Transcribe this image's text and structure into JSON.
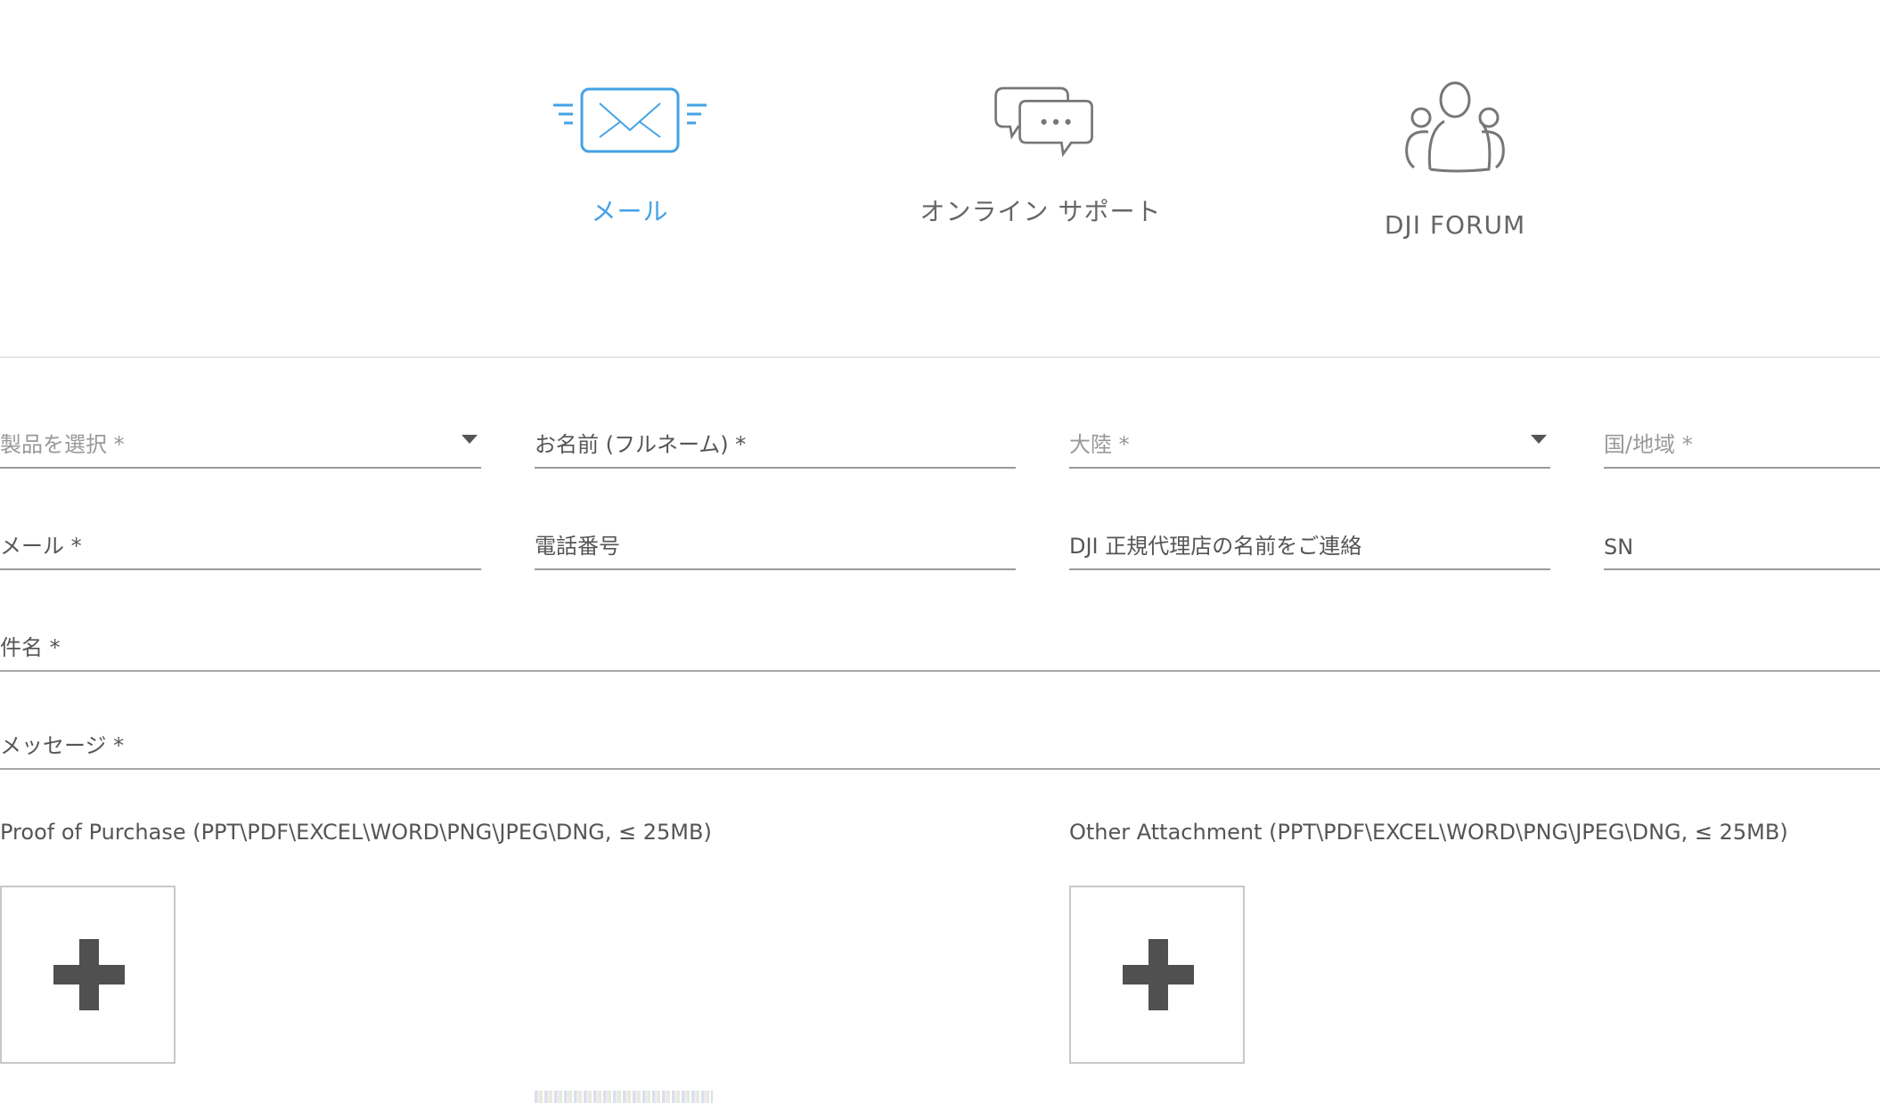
{
  "tabs": [
    {
      "label": "メール",
      "icon": "mail-icon",
      "active": true
    },
    {
      "label": "オンライン サポート",
      "icon": "chat-bubbles-icon",
      "active": false
    },
    {
      "label": "DJI FORUM",
      "icon": "community-icon",
      "active": false
    }
  ],
  "form": {
    "product": "製品を選択 *",
    "full_name": "お名前 (フルネーム) *",
    "continent": "大陸 *",
    "country": "国/地域 *",
    "email": "メール *",
    "phone": "電話番号",
    "dealer": "DJI 正規代理店の名前をご連絡",
    "sn": "SN",
    "subject": "件名 *",
    "message": "メッセージ *"
  },
  "attachments": {
    "proof_label": "Proof of Purchase (PPT\\PDF\\EXCEL\\WORD\\PNG\\JPEG\\DNG, ≤ 25MB)",
    "other_label": "Other Attachment (PPT\\PDF\\EXCEL\\WORD\\PNG\\JPEG\\DNG, ≤ 25MB)"
  },
  "colors": {
    "accent": "#44a2e6",
    "text": "#555555",
    "placeholder_select": "#999999",
    "divider": "#e6e6e6",
    "plus": "#505050"
  }
}
